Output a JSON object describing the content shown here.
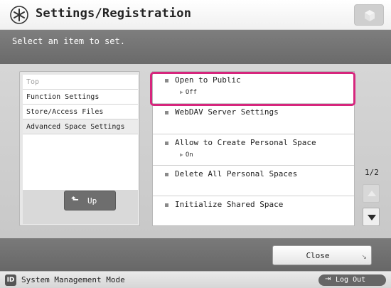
{
  "window": {
    "title": "Settings/Registration",
    "title_icon": "asterisk-circle-icon",
    "cube_icon": "cube-icon"
  },
  "instruction": "Select an item to set.",
  "tree": {
    "items": [
      {
        "label": "Top"
      },
      {
        "label": "Function Settings"
      },
      {
        "label": "Store/Access Files"
      },
      {
        "label": "Advanced Space Settings"
      }
    ],
    "up_label": "Up",
    "up_icon": "up-arrow-icon"
  },
  "settings": {
    "items": [
      {
        "label": "Open to Public",
        "value": "Off"
      },
      {
        "label": "WebDAV Server Settings",
        "value": ""
      },
      {
        "label": "Allow to Create Personal Space",
        "value": "On"
      },
      {
        "label": "Delete All Personal Spaces",
        "value": ""
      },
      {
        "label": "Initialize Shared Space",
        "value": ""
      }
    ],
    "selected_index": 0,
    "highlight_color": "#d6267d"
  },
  "pagination": {
    "indicator": "1/2"
  },
  "footer": {
    "close_label": "Close"
  },
  "status": {
    "badge": "ID",
    "mode": "System Management Mode",
    "logout_label": "Log Out"
  }
}
